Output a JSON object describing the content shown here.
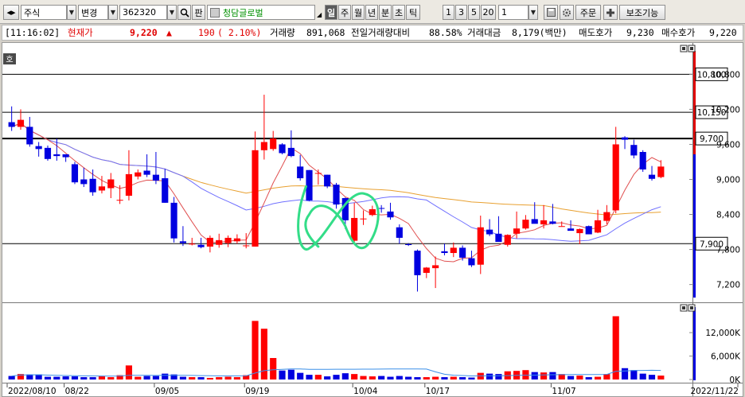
{
  "toolbar": {
    "market_type": "주식",
    "change_label": "변경",
    "stock_code": "362320",
    "pan_label": "판",
    "stock_name": "청담글로벌",
    "periods": [
      "일",
      "주",
      "월",
      "년",
      "분",
      "초",
      "틱"
    ],
    "active_period": "일",
    "intervals": [
      "1",
      "3",
      "5",
      "20"
    ],
    "interval_value": "1",
    "order_label": "주문",
    "aux_label": "보조기능"
  },
  "quote": {
    "time": "[11:16:02]",
    "current_label": "현재가",
    "current_price": "9,220",
    "change_arrow": "▲",
    "change_amount": "190",
    "change_rate": "( 2.10%)",
    "volume_label": "거래량",
    "volume": "891,068",
    "prev_vol_label": "전일거래량대비",
    "prev_vol_ratio": "88.58%",
    "amount_label": "거래대금",
    "amount": "8,179(백만)",
    "ask_label": "매도호가",
    "ask": "9,230",
    "bid_label": "매수호가",
    "bid": "9,220"
  },
  "chart": {
    "corner_button": "호",
    "price_ticks": [
      "10,800",
      "10,200",
      "9,600",
      "9,000",
      "8,400",
      "7,800",
      "7,200"
    ],
    "highlight_levels": [
      "10,800",
      "10,150",
      "9,700",
      "7,900"
    ],
    "volume_ticks": [
      "12,000K",
      "6,000K",
      "0K"
    ],
    "date_labels": [
      "2022/08/10",
      "08/22",
      "09/05",
      "09/19",
      "10/04",
      "10/17",
      "11/07",
      "2022/11/22"
    ],
    "colors": {
      "up": "#ff0000",
      "down": "#0000e0",
      "ma5": "#e05050",
      "ma20": "#7070ff",
      "ma60": "#e8a030",
      "highlight": "#000000",
      "annotation": "#33dd88"
    }
  },
  "chart_data": {
    "type": "candlestick",
    "ohlc": [
      [
        9980,
        10250,
        9830,
        9900
      ],
      [
        9900,
        10200,
        9850,
        10020
      ],
      [
        9900,
        10070,
        9560,
        9600
      ],
      [
        9570,
        9640,
        9390,
        9520
      ],
      [
        9540,
        9580,
        9320,
        9350
      ],
      [
        9430,
        9700,
        9320,
        9400
      ],
      [
        9430,
        9430,
        9300,
        9380
      ],
      [
        9260,
        9300,
        8920,
        8950
      ],
      [
        9000,
        9200,
        8870,
        8920
      ],
      [
        9010,
        9170,
        8720,
        8780
      ],
      [
        8810,
        9060,
        8760,
        8880
      ],
      [
        8850,
        9110,
        8680,
        9000
      ],
      [
        8640,
        8900,
        8580,
        8650
      ],
      [
        8720,
        9500,
        8640,
        9090
      ],
      [
        9050,
        9170,
        9000,
        9120
      ],
      [
        9150,
        9430,
        9040,
        9080
      ],
      [
        9080,
        9470,
        8920,
        8980
      ],
      [
        9020,
        9180,
        8600,
        8600
      ],
      [
        8600,
        8700,
        7920,
        7990
      ],
      [
        7940,
        8200,
        7860,
        7910
      ],
      [
        7900,
        8000,
        7870,
        7900
      ],
      [
        7880,
        8000,
        7820,
        7840
      ],
      [
        7850,
        8040,
        7750,
        8000
      ],
      [
        7880,
        8070,
        7830,
        7960
      ],
      [
        7910,
        8040,
        7840,
        8000
      ],
      [
        7940,
        8060,
        7900,
        7990
      ],
      [
        7870,
        8080,
        7820,
        7870
      ],
      [
        7850,
        9820,
        7850,
        9500
      ],
      [
        9500,
        10450,
        9340,
        9640
      ],
      [
        9520,
        9830,
        9490,
        9700
      ],
      [
        9600,
        9620,
        9430,
        9450
      ],
      [
        9540,
        9840,
        9380,
        9400
      ],
      [
        9220,
        9420,
        8980,
        9020
      ],
      [
        9160,
        9160,
        8630,
        8640
      ],
      [
        9110,
        9170,
        8910,
        9110
      ],
      [
        9080,
        9080,
        8850,
        8880
      ],
      [
        8910,
        8940,
        8500,
        8570
      ],
      [
        8680,
        8690,
        8150,
        8300
      ],
      [
        7950,
        8600,
        7900,
        8340
      ],
      [
        8320,
        8470,
        8220,
        8330
      ],
      [
        8390,
        8550,
        8370,
        8490
      ],
      [
        8510,
        8560,
        8430,
        8500
      ],
      [
        8450,
        8600,
        8310,
        8350
      ],
      [
        8180,
        8230,
        7900,
        8000
      ],
      [
        7890,
        7910,
        7860,
        7880
      ],
      [
        7780,
        7800,
        7080,
        7360
      ],
      [
        7400,
        7500,
        7310,
        7490
      ],
      [
        7480,
        7680,
        7140,
        7530
      ],
      [
        7770,
        7900,
        7700,
        7740
      ],
      [
        7740,
        7920,
        7670,
        7830
      ],
      [
        7830,
        7870,
        7610,
        7660
      ],
      [
        7650,
        7780,
        7500,
        7530
      ],
      [
        7540,
        8380,
        7380,
        8180
      ],
      [
        8140,
        8320,
        8030,
        8060
      ],
      [
        8070,
        8370,
        7950,
        7930
      ],
      [
        7880,
        8060,
        7850,
        8050
      ],
      [
        8070,
        8450,
        7990,
        8160
      ],
      [
        8160,
        8390,
        8140,
        8310
      ],
      [
        8320,
        8610,
        8290,
        8240
      ],
      [
        8230,
        8560,
        8160,
        8300
      ],
      [
        8280,
        8580,
        8230,
        8240
      ],
      [
        8200,
        8280,
        8200,
        8200
      ],
      [
        8160,
        8300,
        8160,
        8120
      ],
      [
        8080,
        8160,
        7890,
        8150
      ],
      [
        8200,
        8210,
        8130,
        8060
      ],
      [
        8090,
        8480,
        8080,
        8300
      ],
      [
        8290,
        8560,
        8230,
        8440
      ],
      [
        8470,
        9900,
        8420,
        9600
      ],
      [
        9720,
        9740,
        9520,
        9680
      ],
      [
        9590,
        9680,
        9360,
        9410
      ],
      [
        9470,
        9500,
        9130,
        9170
      ],
      [
        9080,
        9230,
        8980,
        9010
      ],
      [
        9040,
        9330,
        9020,
        9220
      ]
    ],
    "volume_k": [
      900,
      1400,
      1300,
      1300,
      700,
      700,
      800,
      800,
      600,
      600,
      800,
      600,
      1100,
      3600,
      700,
      900,
      900,
      1500,
      1300,
      700,
      600,
      600,
      400,
      600,
      700,
      600,
      1100,
      15000,
      13000,
      5500,
      2300,
      2500,
      1700,
      1200,
      1200,
      800,
      1200,
      1600,
      1400,
      900,
      800,
      900,
      700,
      900,
      700,
      600,
      600,
      700,
      600,
      700,
      600,
      500,
      1700,
      1500,
      1400,
      2100,
      2200,
      2400,
      1900,
      1800,
      1900,
      1400,
      900,
      1000,
      600,
      700,
      1400,
      16200,
      2900,
      2400,
      1500,
      1200,
      1000
    ],
    "price_axis": {
      "min": 6950,
      "max": 11200
    },
    "volume_axis": {
      "max": 16500
    }
  }
}
